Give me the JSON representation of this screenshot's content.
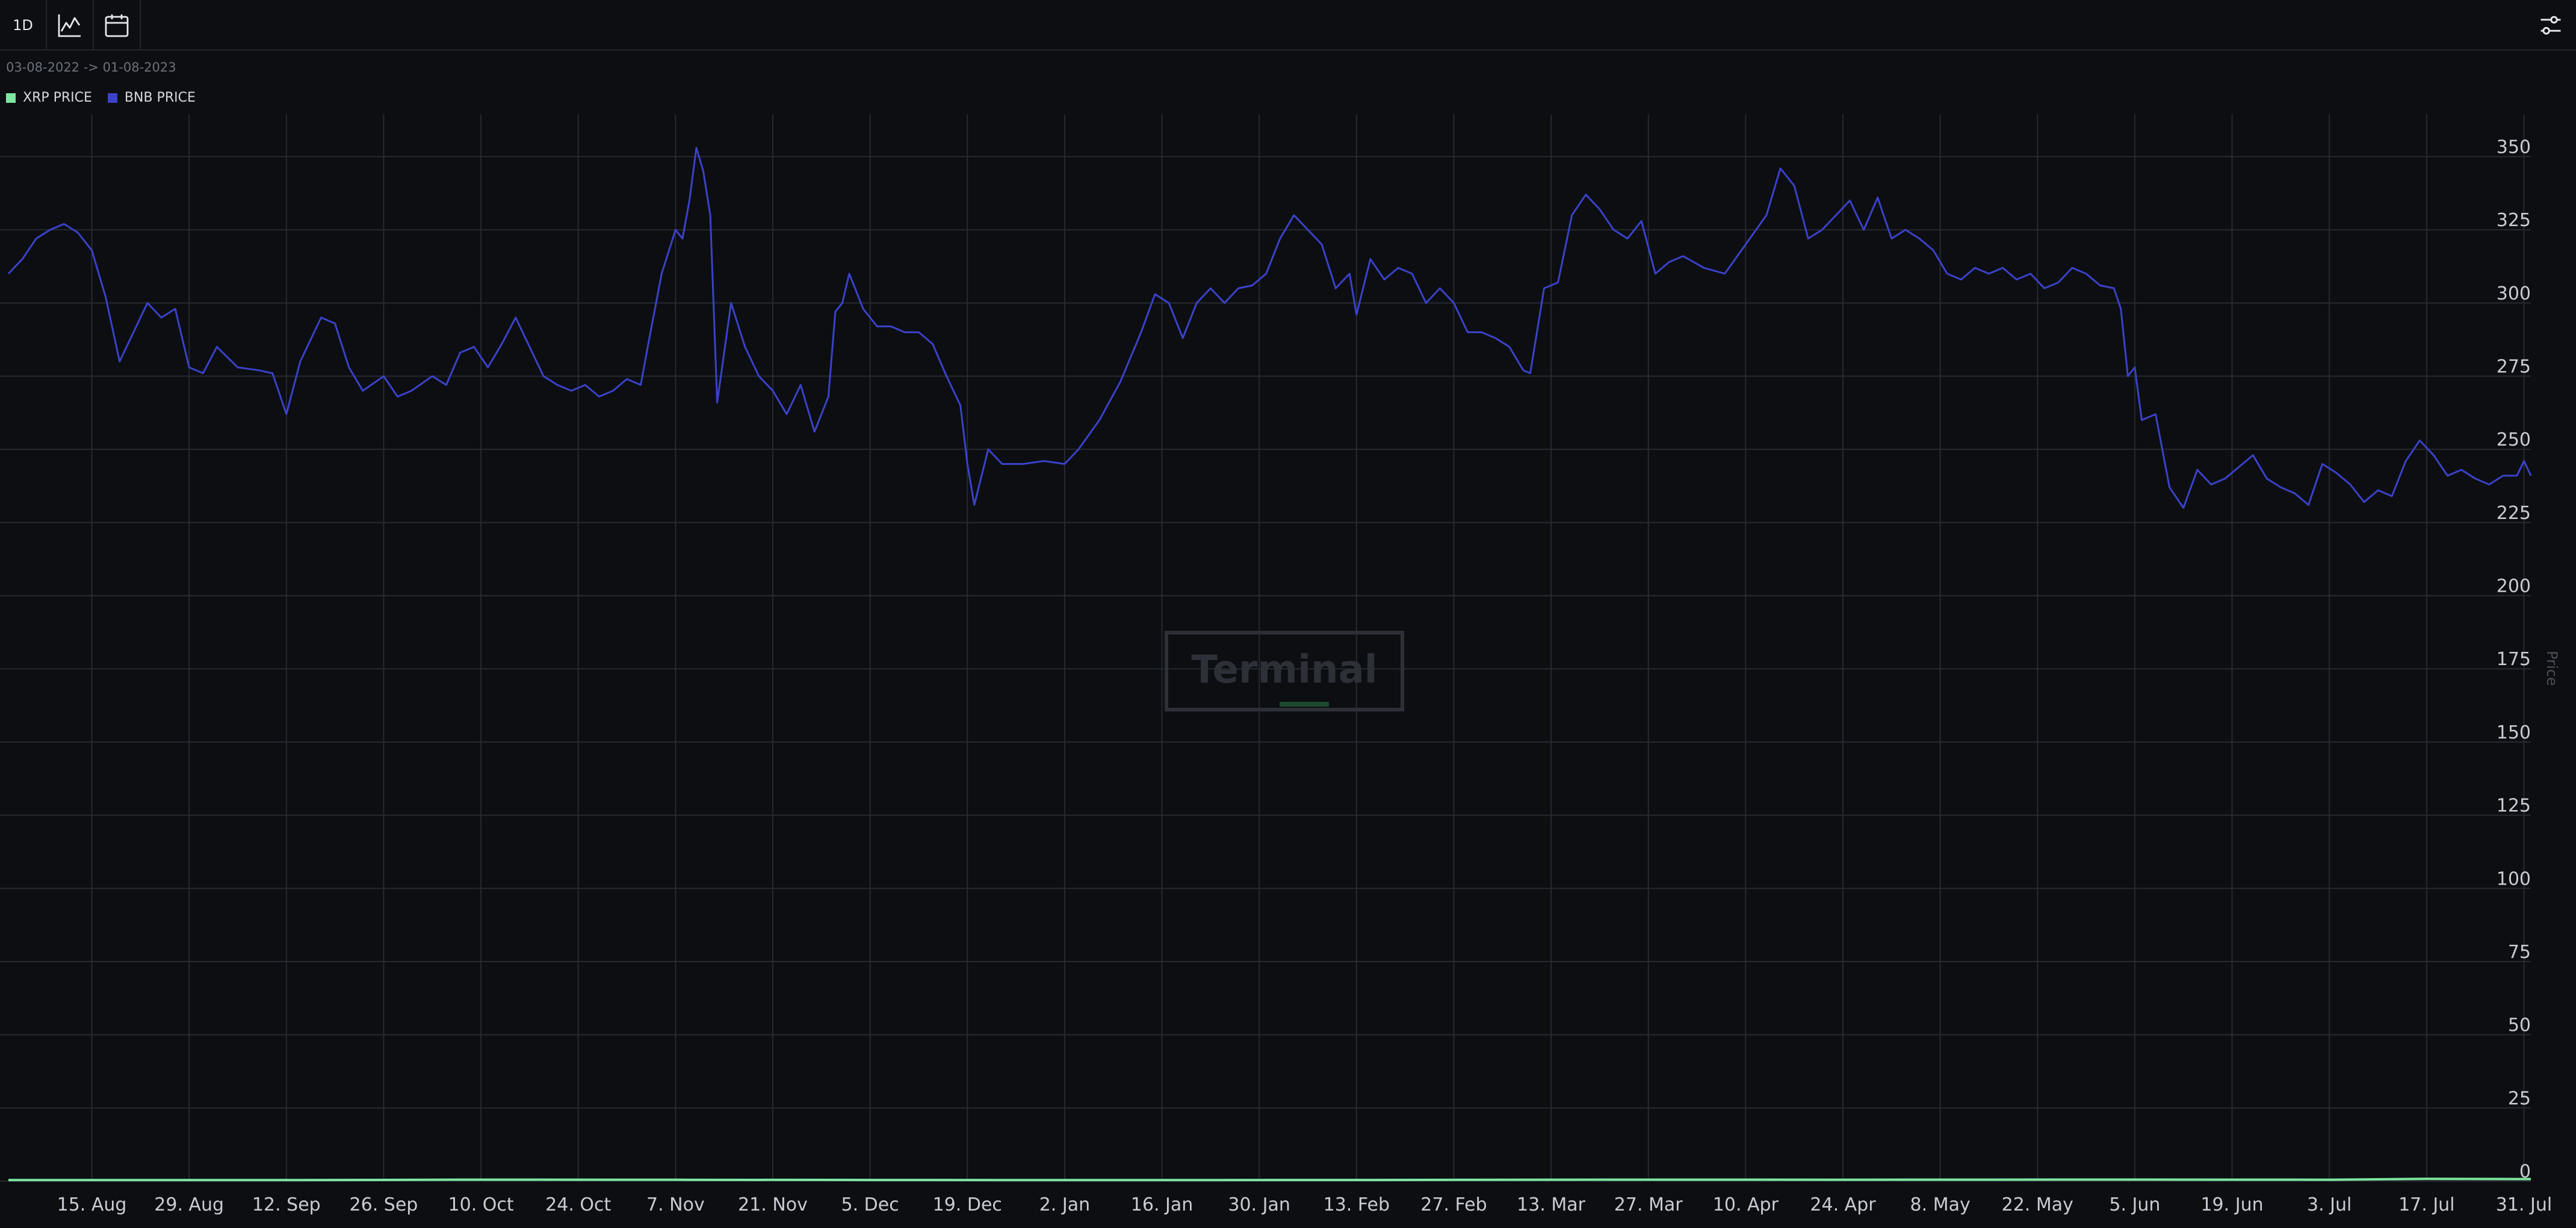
{
  "toolbar": {
    "interval_label": "1D",
    "line_chart_icon": "line-chart-icon",
    "calendar_icon": "calendar-icon",
    "settings_icon": "sliders-icon"
  },
  "date_range": "03-08-2022 -> 01-08-2023",
  "watermark": "Terminal",
  "colors": {
    "background": "#0c0e12",
    "grid": "#262a31",
    "xrp": "#7ee6a0",
    "bnb": "#3b42c9"
  },
  "chart_data": {
    "type": "line",
    "xlabel": "",
    "ylabel": "Price",
    "ylim": [
      0,
      362
    ],
    "yticks": [
      0,
      25,
      50,
      75,
      100,
      125,
      150,
      175,
      200,
      225,
      250,
      275,
      300,
      325,
      350
    ],
    "x_range": [
      "2022-08-03",
      "2023-08-01"
    ],
    "xticks": [
      {
        "date": "2022-08-15",
        "label": "15. Aug"
      },
      {
        "date": "2022-08-29",
        "label": "29. Aug"
      },
      {
        "date": "2022-09-12",
        "label": "12. Sep"
      },
      {
        "date": "2022-09-26",
        "label": "26. Sep"
      },
      {
        "date": "2022-10-10",
        "label": "10. Oct"
      },
      {
        "date": "2022-10-24",
        "label": "24. Oct"
      },
      {
        "date": "2022-11-07",
        "label": "7. Nov"
      },
      {
        "date": "2022-11-21",
        "label": "21. Nov"
      },
      {
        "date": "2022-12-05",
        "label": "5. Dec"
      },
      {
        "date": "2022-12-19",
        "label": "19. Dec"
      },
      {
        "date": "2023-01-02",
        "label": "2. Jan"
      },
      {
        "date": "2023-01-16",
        "label": "16. Jan"
      },
      {
        "date": "2023-01-30",
        "label": "30. Jan"
      },
      {
        "date": "2023-02-13",
        "label": "13. Feb"
      },
      {
        "date": "2023-02-27",
        "label": "27. Feb"
      },
      {
        "date": "2023-03-13",
        "label": "13. Mar"
      },
      {
        "date": "2023-03-27",
        "label": "27. Mar"
      },
      {
        "date": "2023-04-10",
        "label": "10. Apr"
      },
      {
        "date": "2023-04-24",
        "label": "24. Apr"
      },
      {
        "date": "2023-05-08",
        "label": "8. May"
      },
      {
        "date": "2023-05-22",
        "label": "22. May"
      },
      {
        "date": "2023-06-05",
        "label": "5. Jun"
      },
      {
        "date": "2023-06-19",
        "label": "19. Jun"
      },
      {
        "date": "2023-07-03",
        "label": "3. Jul"
      },
      {
        "date": "2023-07-17",
        "label": "17. Jul"
      },
      {
        "date": "2023-07-31",
        "label": "31. Jul"
      }
    ],
    "grid": true,
    "legend_position": "top-left",
    "series": [
      {
        "name": "XRP PRICE",
        "color": "#7ee6a0",
        "points": [
          [
            "2022-08-03",
            0.37
          ],
          [
            "2022-09-12",
            0.34
          ],
          [
            "2022-10-10",
            0.5
          ],
          [
            "2022-11-07",
            0.45
          ],
          [
            "2022-12-05",
            0.39
          ],
          [
            "2023-01-02",
            0.34
          ],
          [
            "2023-02-13",
            0.39
          ],
          [
            "2023-03-27",
            0.5
          ],
          [
            "2023-04-24",
            0.47
          ],
          [
            "2023-06-05",
            0.52
          ],
          [
            "2023-07-03",
            0.48
          ],
          [
            "2023-07-17",
            0.75
          ],
          [
            "2023-08-01",
            0.7
          ]
        ]
      },
      {
        "name": "BNB PRICE",
        "color": "#3b42c9",
        "points": [
          [
            "2022-08-03",
            310
          ],
          [
            "2022-08-05",
            315
          ],
          [
            "2022-08-07",
            322
          ],
          [
            "2022-08-09",
            325
          ],
          [
            "2022-08-11",
            327
          ],
          [
            "2022-08-13",
            324
          ],
          [
            "2022-08-15",
            318
          ],
          [
            "2022-08-17",
            302
          ],
          [
            "2022-08-19",
            280
          ],
          [
            "2022-08-21",
            290
          ],
          [
            "2022-08-23",
            300
          ],
          [
            "2022-08-25",
            295
          ],
          [
            "2022-08-27",
            298
          ],
          [
            "2022-08-29",
            278
          ],
          [
            "2022-08-31",
            276
          ],
          [
            "2022-09-02",
            285
          ],
          [
            "2022-09-05",
            278
          ],
          [
            "2022-09-08",
            277
          ],
          [
            "2022-09-10",
            276
          ],
          [
            "2022-09-12",
            262
          ],
          [
            "2022-09-14",
            280
          ],
          [
            "2022-09-17",
            295
          ],
          [
            "2022-09-19",
            293
          ],
          [
            "2022-09-21",
            278
          ],
          [
            "2022-09-23",
            270
          ],
          [
            "2022-09-26",
            275
          ],
          [
            "2022-09-28",
            268
          ],
          [
            "2022-09-30",
            270
          ],
          [
            "2022-10-03",
            275
          ],
          [
            "2022-10-05",
            272
          ],
          [
            "2022-10-07",
            283
          ],
          [
            "2022-10-09",
            285
          ],
          [
            "2022-10-11",
            278
          ],
          [
            "2022-10-13",
            286
          ],
          [
            "2022-10-15",
            295
          ],
          [
            "2022-10-17",
            285
          ],
          [
            "2022-10-19",
            275
          ],
          [
            "2022-10-21",
            272
          ],
          [
            "2022-10-23",
            270
          ],
          [
            "2022-10-25",
            272
          ],
          [
            "2022-10-27",
            268
          ],
          [
            "2022-10-29",
            270
          ],
          [
            "2022-10-31",
            274
          ],
          [
            "2022-11-02",
            272
          ],
          [
            "2022-11-03",
            285
          ],
          [
            "2022-11-05",
            310
          ],
          [
            "2022-11-07",
            325
          ],
          [
            "2022-11-08",
            322
          ],
          [
            "2022-11-09",
            335
          ],
          [
            "2022-11-10",
            353
          ],
          [
            "2022-11-11",
            345
          ],
          [
            "2022-11-12",
            330
          ],
          [
            "2022-11-13",
            266
          ],
          [
            "2022-11-15",
            300
          ],
          [
            "2022-11-17",
            285
          ],
          [
            "2022-11-19",
            275
          ],
          [
            "2022-11-21",
            270
          ],
          [
            "2022-11-23",
            262
          ],
          [
            "2022-11-25",
            272
          ],
          [
            "2022-11-27",
            256
          ],
          [
            "2022-11-29",
            268
          ],
          [
            "2022-11-30",
            297
          ],
          [
            "2022-12-01",
            300
          ],
          [
            "2022-12-02",
            310
          ],
          [
            "2022-12-04",
            298
          ],
          [
            "2022-12-06",
            292
          ],
          [
            "2022-12-08",
            292
          ],
          [
            "2022-12-10",
            290
          ],
          [
            "2022-12-12",
            290
          ],
          [
            "2022-12-14",
            286
          ],
          [
            "2022-12-16",
            275
          ],
          [
            "2022-12-18",
            265
          ],
          [
            "2022-12-19",
            245
          ],
          [
            "2022-12-20",
            231
          ],
          [
            "2022-12-22",
            250
          ],
          [
            "2022-12-24",
            245
          ],
          [
            "2022-12-27",
            245
          ],
          [
            "2022-12-30",
            246
          ],
          [
            "2023-01-02",
            245
          ],
          [
            "2023-01-04",
            250
          ],
          [
            "2023-01-07",
            260
          ],
          [
            "2023-01-10",
            273
          ],
          [
            "2023-01-13",
            290
          ],
          [
            "2023-01-15",
            303
          ],
          [
            "2023-01-17",
            300
          ],
          [
            "2023-01-19",
            288
          ],
          [
            "2023-01-21",
            300
          ],
          [
            "2023-01-23",
            305
          ],
          [
            "2023-01-25",
            300
          ],
          [
            "2023-01-27",
            305
          ],
          [
            "2023-01-29",
            306
          ],
          [
            "2023-01-31",
            310
          ],
          [
            "2023-02-02",
            322
          ],
          [
            "2023-02-04",
            330
          ],
          [
            "2023-02-06",
            325
          ],
          [
            "2023-02-08",
            320
          ],
          [
            "2023-02-10",
            305
          ],
          [
            "2023-02-12",
            310
          ],
          [
            "2023-02-13",
            296
          ],
          [
            "2023-02-15",
            315
          ],
          [
            "2023-02-17",
            308
          ],
          [
            "2023-02-19",
            312
          ],
          [
            "2023-02-21",
            310
          ],
          [
            "2023-02-23",
            300
          ],
          [
            "2023-02-25",
            305
          ],
          [
            "2023-02-27",
            300
          ],
          [
            "2023-03-01",
            290
          ],
          [
            "2023-03-03",
            290
          ],
          [
            "2023-03-05",
            288
          ],
          [
            "2023-03-07",
            285
          ],
          [
            "2023-03-09",
            277
          ],
          [
            "2023-03-10",
            276
          ],
          [
            "2023-03-12",
            305
          ],
          [
            "2023-03-14",
            307
          ],
          [
            "2023-03-16",
            330
          ],
          [
            "2023-03-18",
            337
          ],
          [
            "2023-03-20",
            332
          ],
          [
            "2023-03-22",
            325
          ],
          [
            "2023-03-24",
            322
          ],
          [
            "2023-03-26",
            328
          ],
          [
            "2023-03-28",
            310
          ],
          [
            "2023-03-30",
            314
          ],
          [
            "2023-04-01",
            316
          ],
          [
            "2023-04-04",
            312
          ],
          [
            "2023-04-07",
            310
          ],
          [
            "2023-04-10",
            320
          ],
          [
            "2023-04-13",
            330
          ],
          [
            "2023-04-15",
            346
          ],
          [
            "2023-04-17",
            340
          ],
          [
            "2023-04-19",
            322
          ],
          [
            "2023-04-21",
            325
          ],
          [
            "2023-04-23",
            330
          ],
          [
            "2023-04-25",
            335
          ],
          [
            "2023-04-27",
            325
          ],
          [
            "2023-04-29",
            336
          ],
          [
            "2023-05-01",
            322
          ],
          [
            "2023-05-03",
            325
          ],
          [
            "2023-05-05",
            322
          ],
          [
            "2023-05-07",
            318
          ],
          [
            "2023-05-09",
            310
          ],
          [
            "2023-05-11",
            308
          ],
          [
            "2023-05-13",
            312
          ],
          [
            "2023-05-15",
            310
          ],
          [
            "2023-05-17",
            312
          ],
          [
            "2023-05-19",
            308
          ],
          [
            "2023-05-21",
            310
          ],
          [
            "2023-05-23",
            305
          ],
          [
            "2023-05-25",
            307
          ],
          [
            "2023-05-27",
            312
          ],
          [
            "2023-05-29",
            310
          ],
          [
            "2023-05-31",
            306
          ],
          [
            "2023-06-02",
            305
          ],
          [
            "2023-06-03",
            298
          ],
          [
            "2023-06-04",
            275
          ],
          [
            "2023-06-05",
            278
          ],
          [
            "2023-06-06",
            260
          ],
          [
            "2023-06-08",
            262
          ],
          [
            "2023-06-10",
            237
          ],
          [
            "2023-06-12",
            230
          ],
          [
            "2023-06-14",
            243
          ],
          [
            "2023-06-16",
            238
          ],
          [
            "2023-06-18",
            240
          ],
          [
            "2023-06-20",
            244
          ],
          [
            "2023-06-22",
            248
          ],
          [
            "2023-06-24",
            240
          ],
          [
            "2023-06-26",
            237
          ],
          [
            "2023-06-28",
            235
          ],
          [
            "2023-06-30",
            231
          ],
          [
            "2023-07-02",
            245
          ],
          [
            "2023-07-04",
            242
          ],
          [
            "2023-07-06",
            238
          ],
          [
            "2023-07-08",
            232
          ],
          [
            "2023-07-10",
            236
          ],
          [
            "2023-07-12",
            234
          ],
          [
            "2023-07-14",
            246
          ],
          [
            "2023-07-16",
            253
          ],
          [
            "2023-07-18",
            248
          ],
          [
            "2023-07-20",
            241
          ],
          [
            "2023-07-22",
            243
          ],
          [
            "2023-07-24",
            240
          ],
          [
            "2023-07-26",
            238
          ],
          [
            "2023-07-28",
            241
          ],
          [
            "2023-07-30",
            241
          ],
          [
            "2023-07-31",
            246
          ],
          [
            "2023-08-01",
            241
          ]
        ]
      }
    ]
  }
}
